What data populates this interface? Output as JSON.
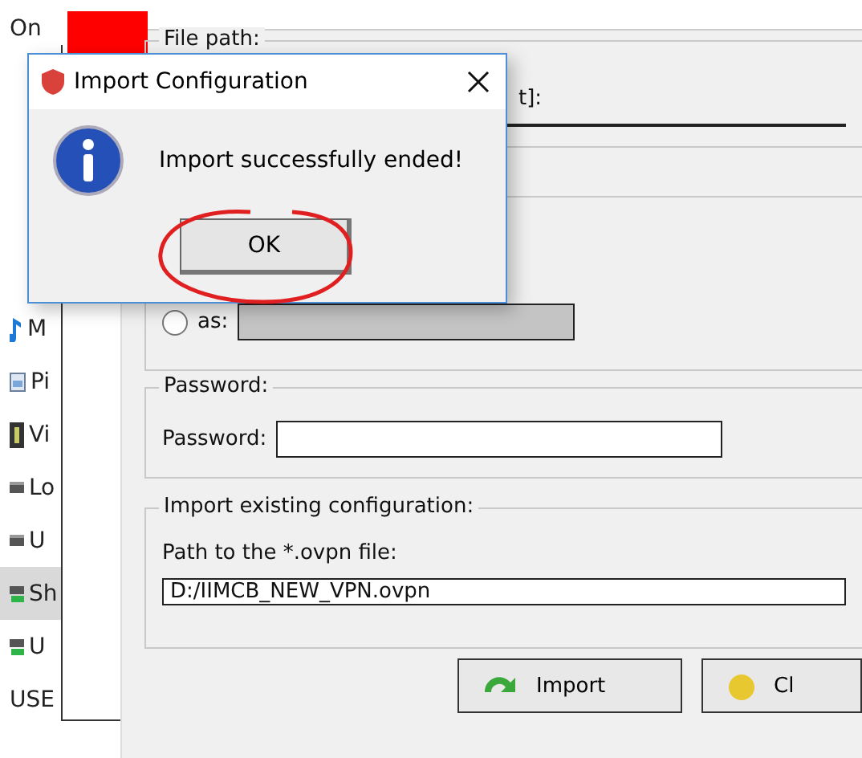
{
  "explorer": {
    "items": [
      {
        "label": "On",
        "kind": "text",
        "selected": false
      },
      {
        "label": "M",
        "kind": "music",
        "selected": false
      },
      {
        "label": "Pi",
        "kind": "pictures",
        "selected": false
      },
      {
        "label": "Vi",
        "kind": "videos",
        "selected": false
      },
      {
        "label": "Lo",
        "kind": "drive",
        "selected": false
      },
      {
        "label": "U",
        "kind": "drive",
        "selected": false
      },
      {
        "label": "Sh",
        "kind": "netdrive",
        "selected": true
      },
      {
        "label": "U",
        "kind": "netdrive",
        "selected": false
      },
      {
        "label": "USE",
        "kind": "text",
        "selected": false
      }
    ]
  },
  "form": {
    "file_group": {
      "legend": "File path:",
      "label": "t]:"
    },
    "name_group": {
      "radio": {
        "label": "as:",
        "selected": false
      }
    },
    "password_group": {
      "legend": "Password:",
      "label": "Password:"
    },
    "import_group": {
      "legend": "Import existing configuration:",
      "label": "Path to the *.ovpn file:",
      "value": "D:/IIMCB_NEW_VPN.ovpn"
    },
    "buttons": [
      {
        "label": "Import",
        "kind": "import"
      },
      {
        "label": "Cl",
        "kind": "close"
      }
    ]
  },
  "dialog": {
    "title": "Import Configuration",
    "message": "Import successfully ended!",
    "button": "OK"
  }
}
